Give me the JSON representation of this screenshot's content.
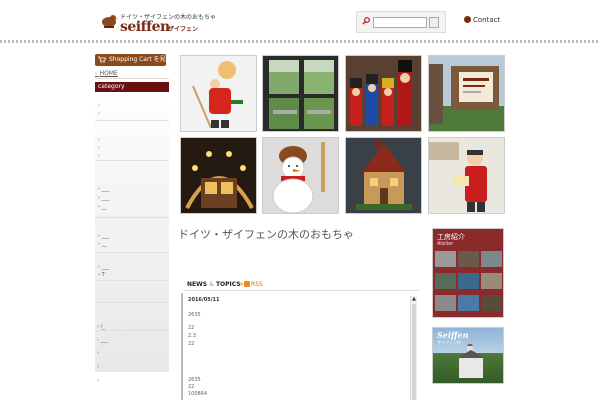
{
  "header": {
    "logo_tagline": "ドイツ・ザイフェンの木のおもちゃ",
    "logo_name": "seiffen",
    "logo_sub": "ザイフェン",
    "search_placeholder": "",
    "contact_label": "Contact"
  },
  "sidebar": {
    "cart_label": "Shopping Cart を見る",
    "home_label": "HOME",
    "category_label": "category",
    "items": [
      {
        "label": "›"
      },
      {
        "label": "›"
      },
      {
        "label": "›"
      },
      {
        "label": "›"
      },
      {
        "label": "›"
      },
      {
        "label": "› ___"
      },
      {
        "label": "› ___"
      },
      {
        "label": "› __"
      },
      {
        "label": "› ___"
      },
      {
        "label": "› __"
      },
      {
        "label": "› ___"
      },
      {
        "label": "› T"
      }
    ],
    "lower_items": [
      {
        "label": "› /_"
      },
      {
        "label": "› ___"
      },
      {
        "label": "›"
      },
      {
        "label": "›"
      },
      {
        "label": "›"
      }
    ]
  },
  "main": {
    "title": "ドイツ・ザイフェンの木のおもちゃ",
    "thumbs": [
      {
        "icon": "smoker-figure-photo"
      },
      {
        "icon": "window-garden-photo"
      },
      {
        "icon": "nutcrackers-photo"
      },
      {
        "icon": "workshop-sign-photo"
      },
      {
        "icon": "candle-arch-photo"
      },
      {
        "icon": "snowman-photo"
      },
      {
        "icon": "wooden-house-photo"
      },
      {
        "icon": "reading-figure-photo"
      }
    ]
  },
  "news": {
    "heading_left": "NEWS",
    "heading_amp": "&",
    "heading_right": "TOPICS",
    "rss_label": "RSS",
    "date": "2016/05/11",
    "lines": [
      "2635",
      "22",
      "2.3",
      "22",
      "2635",
      "22",
      "100864"
    ]
  },
  "right_panel": {
    "workshop_title": "工房紹介",
    "workshop_sub": "Atelier",
    "seiffen_title": "Seiffen",
    "seiffen_sub": "ザイフェン村"
  },
  "colors": {
    "accent": "#6b1010",
    "brand": "#7a2a10",
    "cart": "#8a4a1c",
    "rss": "#f08a24"
  }
}
